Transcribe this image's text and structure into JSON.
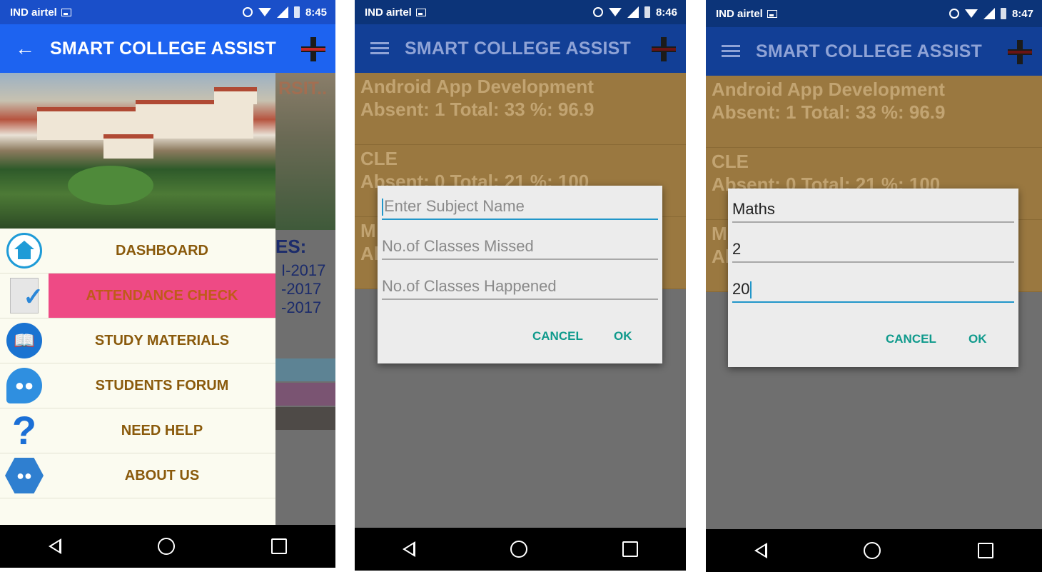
{
  "common": {
    "app_title": "SMART COLLEGE ASSIST",
    "carrier": "IND airtel"
  },
  "phone1": {
    "time": "8:45",
    "bg_photo_text": "RSIT..",
    "bg_heading": "ES:",
    "bg_dates": [
      "I-2017",
      "-2017",
      "-2017"
    ],
    "drawer_items": [
      {
        "label": "DASHBOARD",
        "icon": "home-icon"
      },
      {
        "label": "ATTENDANCE CHECK",
        "icon": "checklist-icon",
        "active": true
      },
      {
        "label": "STUDY MATERIALS",
        "icon": "book-icon"
      },
      {
        "label": "STUDENTS FORUM",
        "icon": "forum-icon"
      },
      {
        "label": "NEED HELP",
        "icon": "question-icon"
      },
      {
        "label": "ABOUT US",
        "icon": "about-us-icon"
      }
    ]
  },
  "phone2": {
    "time": "8:46",
    "subjects": [
      {
        "name": "Android App Development",
        "stats": "Absent: 1 Total: 33 %: 96.9"
      },
      {
        "name": "CLE",
        "stats": "Absent: 0 Total: 21 %: 100"
      },
      {
        "name": "M",
        "stats": "Al"
      }
    ],
    "dialog": {
      "subject_placeholder": "Enter Subject Name",
      "missed_placeholder": "No.of Classes Missed",
      "happened_placeholder": "No.of Classes Happened",
      "cancel": "CANCEL",
      "ok": "OK"
    }
  },
  "phone3": {
    "time": "8:47",
    "subjects": [
      {
        "name": "Android App Development",
        "stats": "Absent: 1 Total: 33 %: 96.9"
      },
      {
        "name": "CLE",
        "stats": "Absent: 0 Total: 21 %: 100"
      },
      {
        "name": "M",
        "stats": "Al"
      }
    ],
    "dialog": {
      "subject_value": "Maths",
      "missed_value": "2",
      "happened_value": "20",
      "cancel": "CANCEL",
      "ok": "OK"
    }
  },
  "colors": {
    "appbar_blue": "#1d63f0",
    "status_blue": "#1a4fc9",
    "drawer_active": "#ee4a85",
    "drawer_label": "#8a5a0c",
    "dialog_button": "#0f9a8c",
    "field_focus": "#2196c9"
  }
}
